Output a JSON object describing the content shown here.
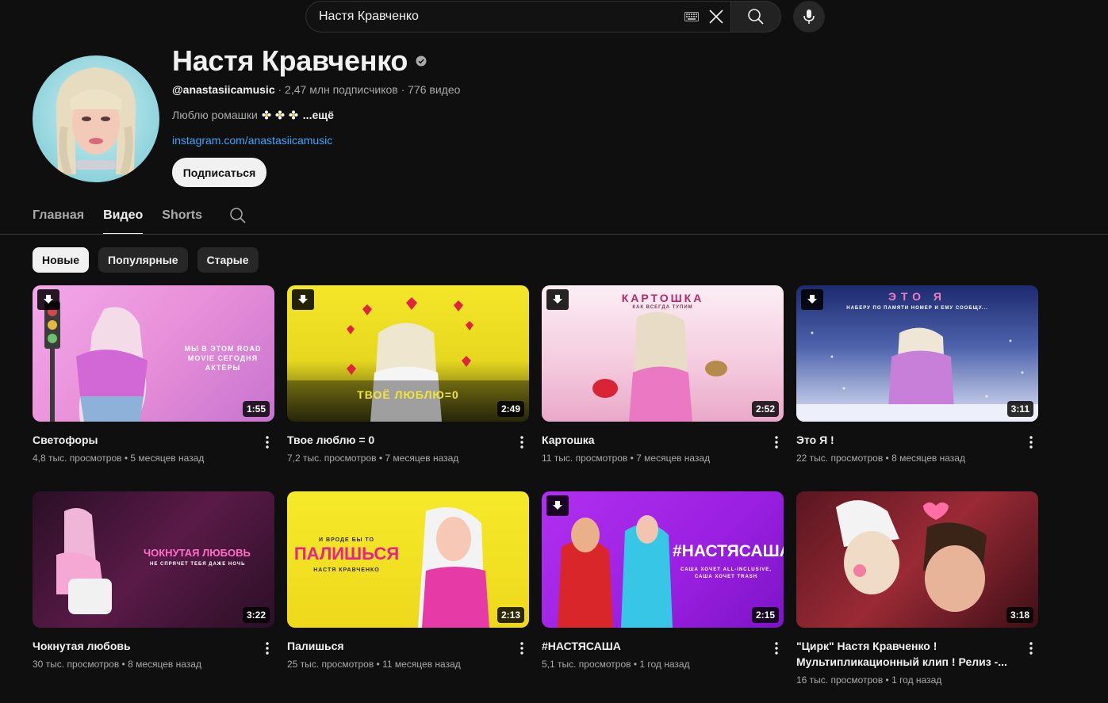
{
  "search": {
    "query": "Настя Кравченко"
  },
  "channel": {
    "name": "Настя Кравченко",
    "handle": "@anastasiicamusic",
    "stats": " · 2,47 млн подписчиков · 776 видео",
    "description": "Люблю ромашки",
    "more_label": "...ещё",
    "link": "instagram.com/anastasiicamusic",
    "subscribe_label": "Подписаться"
  },
  "tabs": [
    {
      "label": "Главная",
      "active": false
    },
    {
      "label": "Видео",
      "active": true
    },
    {
      "label": "Shorts",
      "active": false
    }
  ],
  "chips": [
    {
      "label": "Новые",
      "active": true
    },
    {
      "label": "Популярные",
      "active": false
    },
    {
      "label": "Старые",
      "active": false
    }
  ],
  "videos": [
    {
      "title": "Светофоры",
      "meta": "4,8 тыс. просмотров • 5 месяцев назад",
      "duration": "1:55",
      "download_badge": true,
      "thumb_text": "МЫ В ЭТОМ ROAD MOVIE СЕГОДНЯ АКТЁРЫ"
    },
    {
      "title": "Твое люблю = 0",
      "meta": "7,2 тыс. просмотров • 7 месяцев назад",
      "duration": "2:49",
      "download_badge": true,
      "thumb_text": "ТВОЁ ЛЮБЛЮ=0"
    },
    {
      "title": "Картошка",
      "meta": "11 тыс. просмотров • 7 месяцев назад",
      "duration": "2:52",
      "download_badge": true,
      "thumb_text": "КАРТОШКА",
      "thumb_sub": "КАК ВСЕГДА ТУПИМ"
    },
    {
      "title": "Это Я !",
      "meta": "22 тыс. просмотров • 8 месяцев назад",
      "duration": "3:11",
      "download_badge": true,
      "thumb_text": "ЭТО Я",
      "thumb_sub": "НАБЕРУ ПО ПАМЯТИ НОМЕР И ЕМУ СООБЩУ..."
    },
    {
      "title": "Чокнутая любовь",
      "meta": "30 тыс. просмотров • 8 месяцев назад",
      "duration": "3:22",
      "download_badge": false,
      "thumb_text": "ЧОКНУТАЯ ЛЮБОВЬ",
      "thumb_sub": "НЕ СПРЯЧЕТ ТЕБЯ ДАЖЕ НОЧЬ"
    },
    {
      "title": "Палишься",
      "meta": "25 тыс. просмотров • 11 месяцев назад",
      "duration": "2:13",
      "download_badge": false,
      "thumb_text": "ПАЛИШЬСЯ",
      "thumb_pre": "И ВРОДЕ БЫ ТО",
      "thumb_sub": "НАСТЯ КРАВЧЕНКО"
    },
    {
      "title": "#НАСТЯСАША",
      "meta": "5,1 тыс. просмотров • 1 год назад",
      "duration": "2:15",
      "download_badge": true,
      "thumb_text": "#НАСТЯСАША",
      "thumb_sub": "САША ХОЧЕТ ALL-INCLUSIVE, САША ХОЧЕТ TRASH"
    },
    {
      "title": "\"Цирк\" Настя Кравченко ! Мультипликационный клип ! Релиз -...",
      "meta": "16 тыс. просмотров • 1 год назад",
      "duration": "3:18",
      "download_badge": false
    }
  ],
  "colors": {
    "background": "#0f0f0f",
    "link": "#3ea6ff",
    "text_secondary": "#aaaaaa"
  }
}
